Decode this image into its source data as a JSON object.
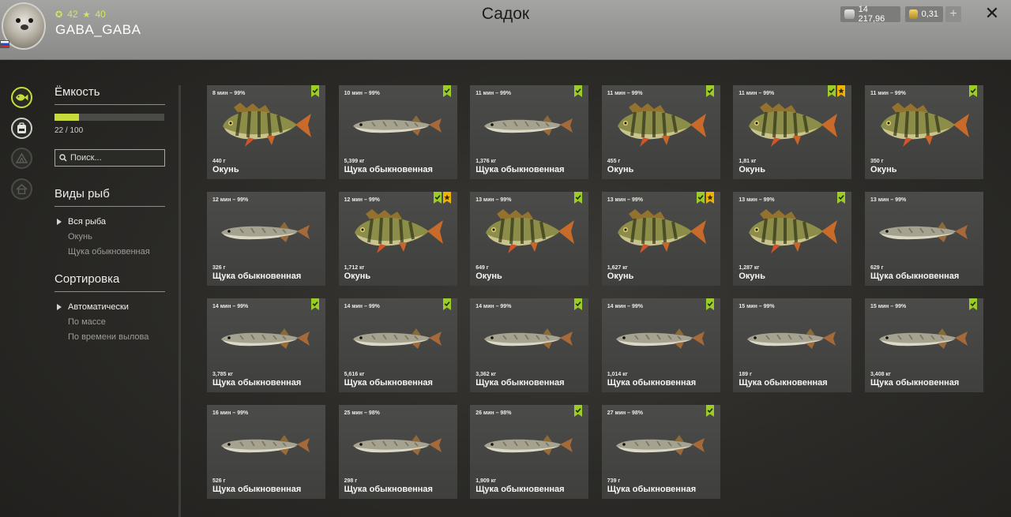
{
  "header": {
    "title": "Садок",
    "username": "GABA_GABA",
    "level": "42",
    "rank": "40",
    "silver": "14 217,96",
    "gold": "0,31"
  },
  "panel": {
    "capacity_title": "Ёмкость",
    "capacity_used": 22,
    "capacity_max": 100,
    "capacity_text": "22 / 100",
    "search_placeholder": "Поиск...",
    "species_title": "Виды рыб",
    "species": [
      {
        "label": "Вся рыба",
        "selected": true
      },
      {
        "label": "Окунь",
        "selected": false
      },
      {
        "label": "Щука обыкновенная",
        "selected": false
      }
    ],
    "sort_title": "Сортировка",
    "sort_options": [
      {
        "label": "Автоматически",
        "selected": true
      },
      {
        "label": "По массе",
        "selected": false
      },
      {
        "label": "По времени вылова",
        "selected": false
      }
    ]
  },
  "colors": {
    "accent": "#c7dc3c",
    "badge_green": "#9ccc28",
    "badge_gold": "#f0b400",
    "perch_body": "#8a8c4a",
    "pike_body": "#a8a490"
  },
  "icons": [
    "fish-icon",
    "backpack-icon",
    "tent-icon",
    "home-icon"
  ],
  "fish": [
    {
      "time": "8 мин – 99%",
      "weight": "440 г",
      "name": "Окунь",
      "type": "perch",
      "badges": [
        "green"
      ]
    },
    {
      "time": "10 мин – 99%",
      "weight": "5,399 кг",
      "name": "Щука обыкновенная",
      "type": "pike",
      "badges": [
        "green"
      ]
    },
    {
      "time": "11 мин – 99%",
      "weight": "1,376 кг",
      "name": "Щука обыкновенная",
      "type": "pike",
      "badges": [
        "green"
      ]
    },
    {
      "time": "11 мин – 99%",
      "weight": "455 г",
      "name": "Окунь",
      "type": "perch",
      "badges": [
        "green"
      ]
    },
    {
      "time": "11 мин – 99%",
      "weight": "1,81 кг",
      "name": "Окунь",
      "type": "perch",
      "badges": [
        "green",
        "gold"
      ]
    },
    {
      "time": "11 мин – 99%",
      "weight": "350 г",
      "name": "Окунь",
      "type": "perch",
      "badges": [
        "green"
      ]
    },
    {
      "time": "12 мин – 99%",
      "weight": "326 г",
      "name": "Щука обыкновенная",
      "type": "pike",
      "badges": []
    },
    {
      "time": "12 мин – 99%",
      "weight": "1,712 кг",
      "name": "Окунь",
      "type": "perch",
      "badges": [
        "green",
        "gold"
      ]
    },
    {
      "time": "13 мин – 99%",
      "weight": "649 г",
      "name": "Окунь",
      "type": "perch",
      "badges": [
        "green"
      ]
    },
    {
      "time": "13 мин – 99%",
      "weight": "1,627 кг",
      "name": "Окунь",
      "type": "perch",
      "badges": [
        "green",
        "gold"
      ]
    },
    {
      "time": "13 мин – 99%",
      "weight": "1,287 кг",
      "name": "Окунь",
      "type": "perch",
      "badges": [
        "green"
      ]
    },
    {
      "time": "13 мин – 99%",
      "weight": "629 г",
      "name": "Щука обыкновенная",
      "type": "pike",
      "badges": []
    },
    {
      "time": "14 мин – 99%",
      "weight": "3,785 кг",
      "name": "Щука обыкновенная",
      "type": "pike",
      "badges": [
        "green"
      ]
    },
    {
      "time": "14 мин – 99%",
      "weight": "5,616 кг",
      "name": "Щука обыкновенная",
      "type": "pike",
      "badges": [
        "green"
      ]
    },
    {
      "time": "14 мин – 99%",
      "weight": "3,362 кг",
      "name": "Щука обыкновенная",
      "type": "pike",
      "badges": [
        "green"
      ]
    },
    {
      "time": "14 мин – 99%",
      "weight": "1,014 кг",
      "name": "Щука обыкновенная",
      "type": "pike",
      "badges": [
        "green"
      ]
    },
    {
      "time": "15 мин – 99%",
      "weight": "189 г",
      "name": "Щука обыкновенная",
      "type": "pike",
      "badges": []
    },
    {
      "time": "15 мин – 99%",
      "weight": "3,408 кг",
      "name": "Щука обыкновенная",
      "type": "pike",
      "badges": [
        "green"
      ]
    },
    {
      "time": "16 мин – 99%",
      "weight": "526 г",
      "name": "Щука обыкновенная",
      "type": "pike",
      "badges": []
    },
    {
      "time": "25 мин – 98%",
      "weight": "298 г",
      "name": "Щука обыкновенная",
      "type": "pike",
      "badges": []
    },
    {
      "time": "26 мин – 98%",
      "weight": "1,909 кг",
      "name": "Щука обыкновенная",
      "type": "pike",
      "badges": [
        "green"
      ]
    },
    {
      "time": "27 мин – 98%",
      "weight": "739 г",
      "name": "Щука обыкновенная",
      "type": "pike",
      "badges": [
        "green"
      ]
    }
  ]
}
